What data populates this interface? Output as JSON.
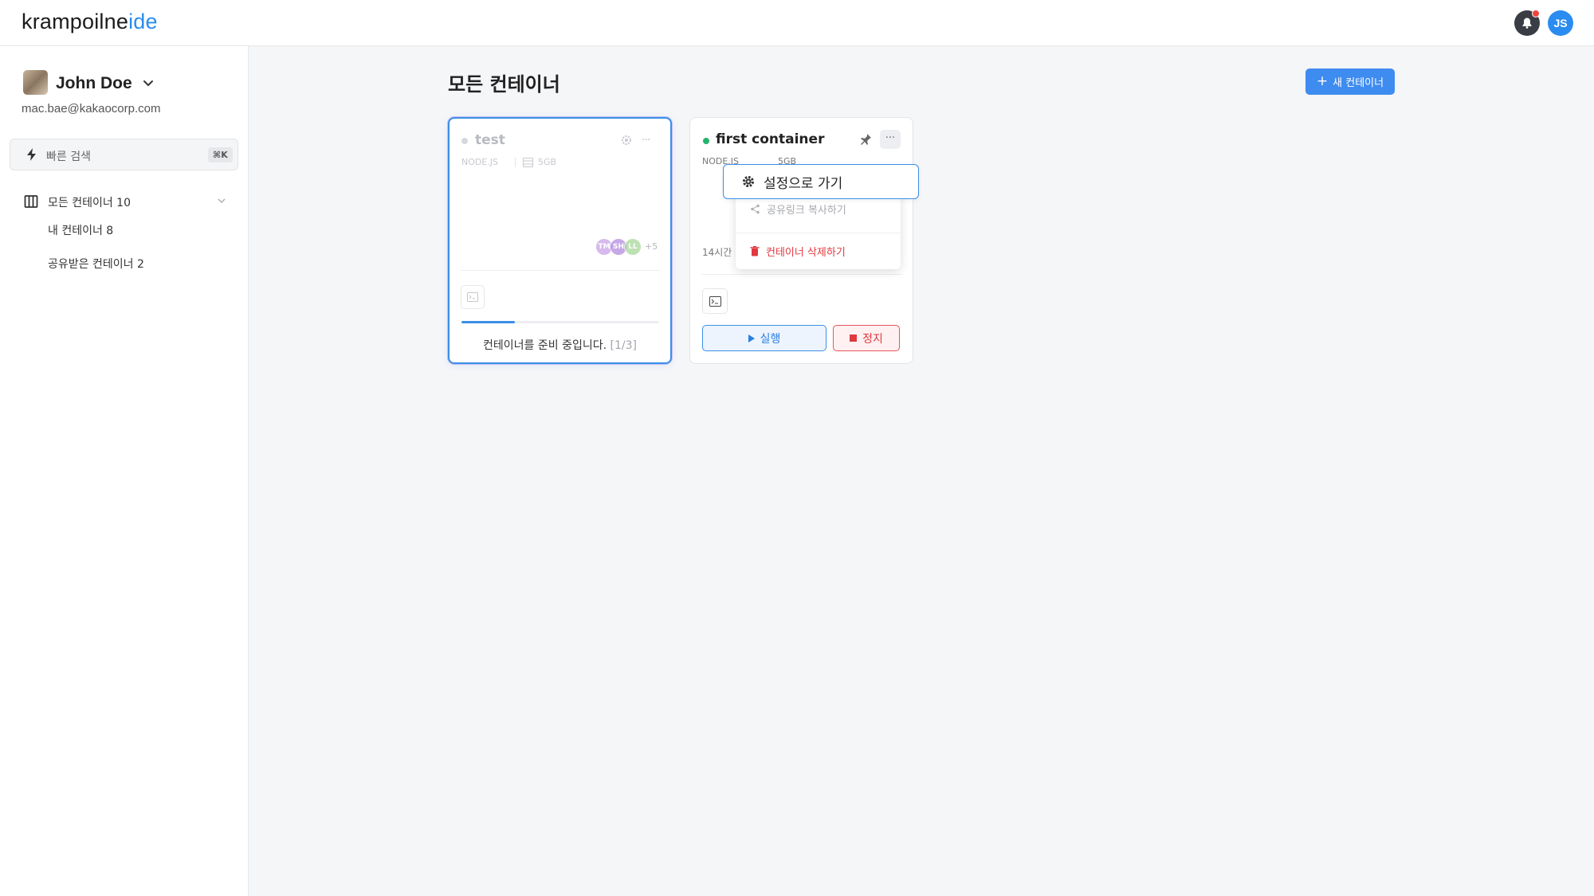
{
  "header": {
    "logo_main": "krampoilne",
    "logo_accent": "ide",
    "user_initials": "JS"
  },
  "sidebar": {
    "user_name": "John Doe",
    "user_email": "mac.bae@kakaocorp.com",
    "quick_search_label": "빠른 검색",
    "quick_search_shortcut": "⌘K",
    "nav_all_label": "모든 컨테이너 10",
    "nav_mine_label": "내 컨테이너 8",
    "nav_shared_label": "공유받은 컨테이너 2"
  },
  "main": {
    "title": "모든 컨테이너",
    "new_button_label": "새 컨테이너"
  },
  "cards": [
    {
      "name": "test",
      "runtime": "NODE.JS",
      "disk": "5GB",
      "members": [
        "TM",
        "SH",
        "LL"
      ],
      "members_more": "+5",
      "progress": 0.27,
      "status_text": "컨테이너를 준비 중입니다.",
      "status_step": "[1/3]"
    },
    {
      "name": "first container",
      "runtime": "NODE.JS",
      "disk": "5GB",
      "time_text": "14시간 전",
      "run_label": "실행",
      "stop_label": "정지"
    }
  ],
  "menu": {
    "settings_label": "설정으로 가기",
    "share_label": "공유링크 복사하기",
    "delete_label": "컨테이너 삭제하기"
  },
  "colors": {
    "accent": "#2a8cf0",
    "running": "#24b36b",
    "danger": "#e0383f"
  }
}
